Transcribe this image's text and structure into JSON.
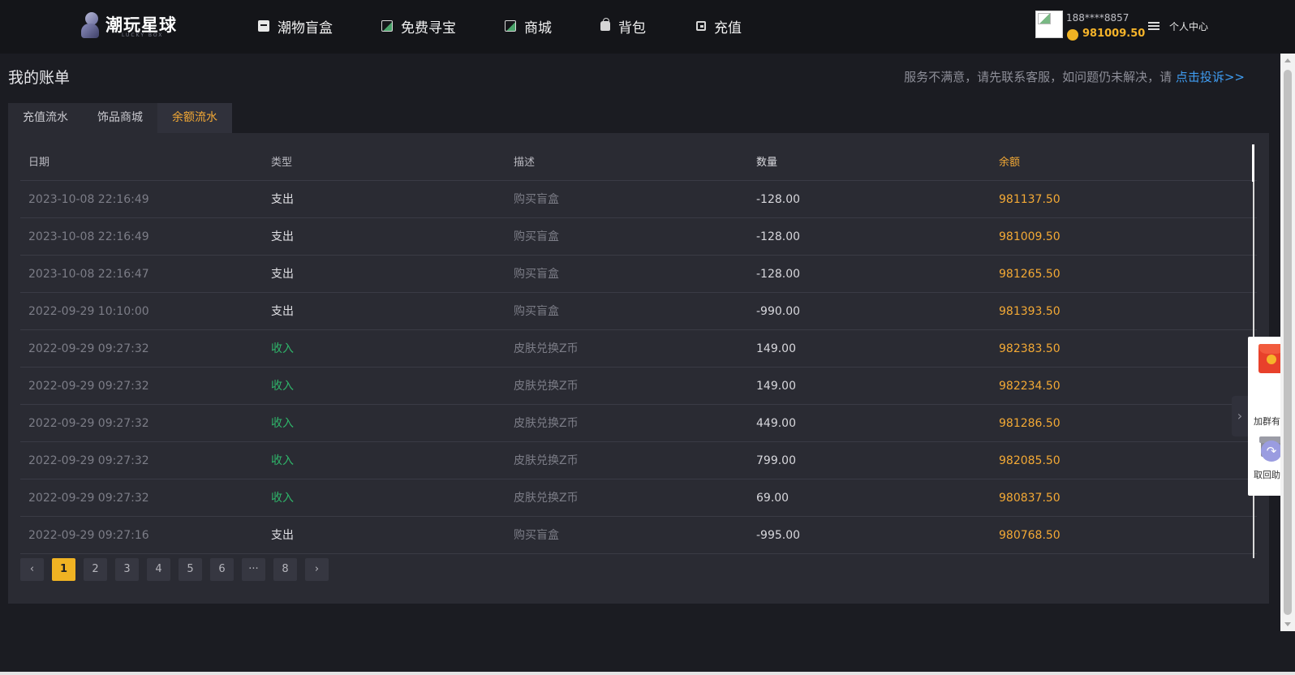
{
  "header": {
    "logo_text": "潮玩星球",
    "logo_sub": "LUCKY BOX",
    "nav": [
      {
        "label": "潮物盲盒",
        "icon": "box-icon"
      },
      {
        "label": "免费寻宝",
        "icon": "image-icon"
      },
      {
        "label": "商城",
        "icon": "image-icon"
      },
      {
        "label": "背包",
        "icon": "bag-icon"
      },
      {
        "label": "充值",
        "icon": "wallet-icon"
      }
    ],
    "user": {
      "phone": "188****8857",
      "balance": "981009.50",
      "center_label": "个人中心"
    }
  },
  "page": {
    "title": "我的账单",
    "notice_text": "服务不满意，请先联系客服，如问题仍未解决，请",
    "notice_link": "点击投诉>>"
  },
  "tabs": [
    {
      "label": "充值流水",
      "active": false
    },
    {
      "label": "饰品商城",
      "active": false
    },
    {
      "label": "余额流水",
      "active": true
    }
  ],
  "table": {
    "headers": [
      "日期",
      "类型",
      "描述",
      "数量",
      "余额"
    ],
    "rows": [
      {
        "date": "2023-10-08 22:16:49",
        "type": "支出",
        "desc": "购买盲盒",
        "amount": "-128.00",
        "balance": "981137.50"
      },
      {
        "date": "2023-10-08 22:16:49",
        "type": "支出",
        "desc": "购买盲盒",
        "amount": "-128.00",
        "balance": "981009.50"
      },
      {
        "date": "2023-10-08 22:16:47",
        "type": "支出",
        "desc": "购买盲盒",
        "amount": "-128.00",
        "balance": "981265.50"
      },
      {
        "date": "2022-09-29 10:10:00",
        "type": "支出",
        "desc": "购买盲盒",
        "amount": "-990.00",
        "balance": "981393.50"
      },
      {
        "date": "2022-09-29 09:27:32",
        "type": "收入",
        "desc": "皮肤兑换Z币",
        "amount": "149.00",
        "balance": "982383.50"
      },
      {
        "date": "2022-09-29 09:27:32",
        "type": "收入",
        "desc": "皮肤兑换Z币",
        "amount": "149.00",
        "balance": "982234.50"
      },
      {
        "date": "2022-09-29 09:27:32",
        "type": "收入",
        "desc": "皮肤兑换Z币",
        "amount": "449.00",
        "balance": "981286.50"
      },
      {
        "date": "2022-09-29 09:27:32",
        "type": "收入",
        "desc": "皮肤兑换Z币",
        "amount": "799.00",
        "balance": "982085.50"
      },
      {
        "date": "2022-09-29 09:27:32",
        "type": "收入",
        "desc": "皮肤兑换Z币",
        "amount": "69.00",
        "balance": "980837.50"
      },
      {
        "date": "2022-09-29 09:27:16",
        "type": "支出",
        "desc": "购买盲盒",
        "amount": "-995.00",
        "balance": "980768.50"
      }
    ]
  },
  "pagination": {
    "prev": "‹",
    "pages": [
      "1",
      "2",
      "3",
      "4",
      "5",
      "6",
      "···",
      "8"
    ],
    "current": "1",
    "next": "›"
  },
  "side_float": {
    "items": [
      "加群有奖",
      "取回助手"
    ]
  },
  "colors": {
    "accent": "#f3a935",
    "income": "#2fb56a",
    "link": "#3f9cf0",
    "background": "#1b1c22",
    "panel": "#2a2b33"
  }
}
